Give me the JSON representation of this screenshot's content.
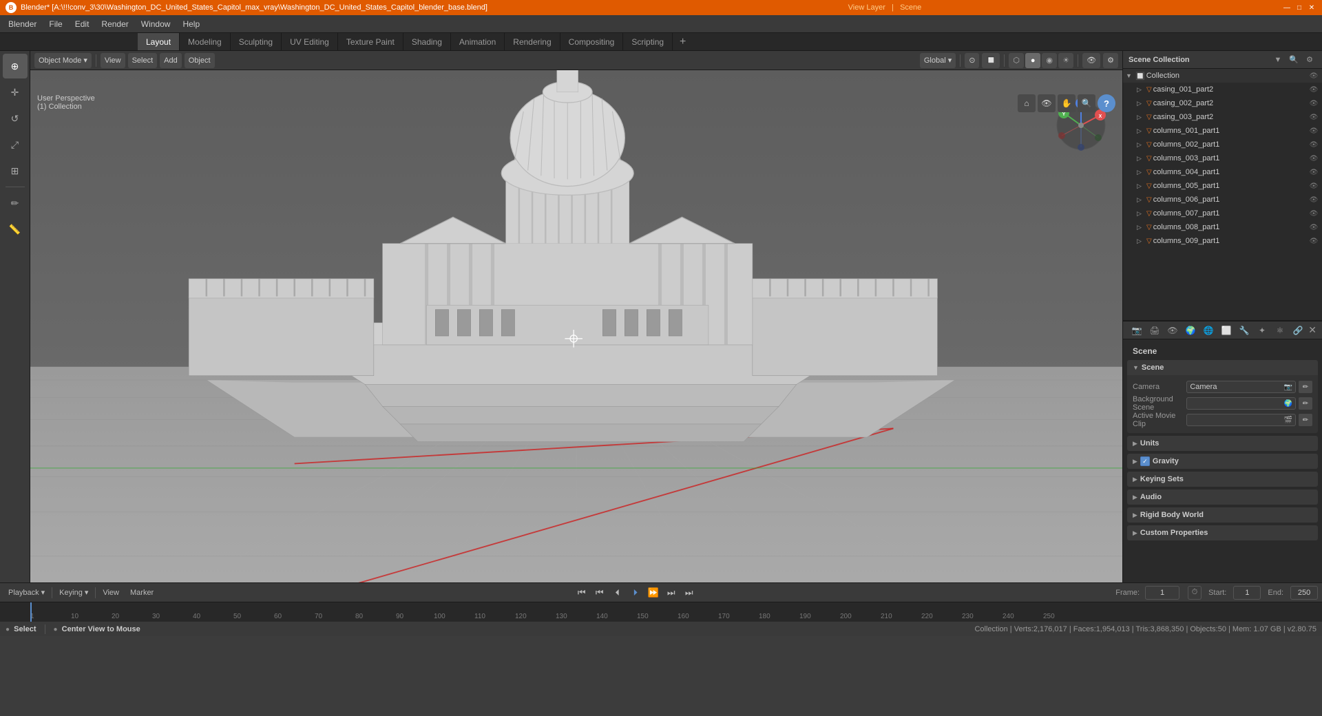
{
  "titleBar": {
    "title": "Blender* [A:\\!!!conv_3\\30\\Washington_DC_United_States_Capitol_max_vray\\Washington_DC_United_States_Capitol_blender_base.blend]",
    "logoText": "B",
    "controls": [
      "—",
      "□",
      "✕"
    ]
  },
  "menuBar": {
    "items": [
      "Blender",
      "File",
      "Edit",
      "Render",
      "Window",
      "Help"
    ]
  },
  "workspaceTabs": {
    "tabs": [
      "Layout",
      "Modeling",
      "Sculpting",
      "UV Editing",
      "Texture Paint",
      "Shading",
      "Animation",
      "Rendering",
      "Compositing",
      "Scripting"
    ],
    "activeTab": "Layout",
    "addLabel": "+"
  },
  "viewport": {
    "headerButtons": {
      "viewMenu": "Object Mode",
      "viewDropdown": "▾",
      "view": "View",
      "select": "Select",
      "add": "Add",
      "object": "Object"
    },
    "info": {
      "line1": "User Perspective",
      "line2": "(1) Collection"
    },
    "overlayInfo": {
      "global": "Global",
      "shadingLabel": "●"
    },
    "shadingBtns": [
      "⬡",
      "●",
      "◉",
      "☀"
    ],
    "navigationGizmo": {
      "x": "X",
      "y": "Y",
      "z": "Z",
      "nx": "-X",
      "ny": "-Y",
      "nz": "-Z"
    }
  },
  "outliner": {
    "title": "Scene Collection",
    "items": [
      {
        "name": "Collection",
        "type": "collection",
        "indent": 0,
        "expanded": true
      },
      {
        "name": "casing_001_part2",
        "type": "mesh",
        "indent": 1
      },
      {
        "name": "casing_002_part2",
        "type": "mesh",
        "indent": 1
      },
      {
        "name": "casing_003_part2",
        "type": "mesh",
        "indent": 1
      },
      {
        "name": "columns_001_part1",
        "type": "mesh",
        "indent": 1
      },
      {
        "name": "columns_002_part1",
        "type": "mesh",
        "indent": 1
      },
      {
        "name": "columns_003_part1",
        "type": "mesh",
        "indent": 1
      },
      {
        "name": "columns_004_part1",
        "type": "mesh",
        "indent": 1
      },
      {
        "name": "columns_005_part1",
        "type": "mesh",
        "indent": 1
      },
      {
        "name": "columns_006_part1",
        "type": "mesh",
        "indent": 1
      },
      {
        "name": "columns_007_part1",
        "type": "mesh",
        "indent": 1
      },
      {
        "name": "columns_008_part1",
        "type": "mesh",
        "indent": 1
      },
      {
        "name": "columns_009_part1",
        "type": "mesh",
        "indent": 1
      }
    ]
  },
  "properties": {
    "title": "Scene",
    "tabs": [
      "🎬",
      "🌍",
      "⚙",
      "📷",
      "🔆",
      "🌊",
      "👁",
      "🎨",
      "🔩"
    ],
    "sections": [
      {
        "name": "Scene",
        "label": "Scene",
        "expanded": true,
        "rows": [
          {
            "label": "Camera",
            "value": "Camera",
            "hasIcon": true,
            "iconType": "camera"
          },
          {
            "label": "Background Scene",
            "value": "",
            "hasIcon": true,
            "iconType": "scene"
          },
          {
            "label": "Active Movie Clip",
            "value": "",
            "hasIcon": true,
            "iconType": "movie"
          }
        ]
      },
      {
        "name": "Units",
        "label": "Units",
        "expanded": false
      },
      {
        "name": "Gravity",
        "label": "Gravity",
        "expanded": false,
        "hasCheckbox": true,
        "checked": true
      },
      {
        "name": "Keying Sets",
        "label": "Keying Sets",
        "expanded": false
      },
      {
        "name": "Audio",
        "label": "Audio",
        "expanded": false
      },
      {
        "name": "Rigid Body World",
        "label": "Rigid Body World",
        "expanded": false
      },
      {
        "name": "Custom Properties",
        "label": "Custom Properties",
        "expanded": false
      }
    ]
  },
  "timeline": {
    "playbackLabel": "Playback",
    "keyingLabel": "Keying",
    "viewLabel": "View",
    "markerLabel": "Marker",
    "transportButtons": [
      "⏮",
      "⏮",
      "⏪",
      "⏴",
      "⏵",
      "⏩",
      "⏭"
    ],
    "currentFrame": "1",
    "startLabel": "Start:",
    "startFrame": "1",
    "endLabel": "End:",
    "endFrame": "250",
    "frameMarkers": [
      "1",
      "10",
      "20",
      "30",
      "40",
      "50",
      "60",
      "70",
      "80",
      "90",
      "100",
      "110",
      "120",
      "130",
      "140",
      "150",
      "160",
      "170",
      "180",
      "190",
      "200",
      "210",
      "220",
      "230",
      "240",
      "250"
    ]
  },
  "statusBar": {
    "left": {
      "selectKey": "Select",
      "centerKey": "Center View to Mouse"
    },
    "right": {
      "info": "Collection | Verts:2,176,017 | Faces:1,954,013 | Tris:3,868,350 | Objects:50 | Mem: 1.07 GB | v2.80.75"
    }
  }
}
